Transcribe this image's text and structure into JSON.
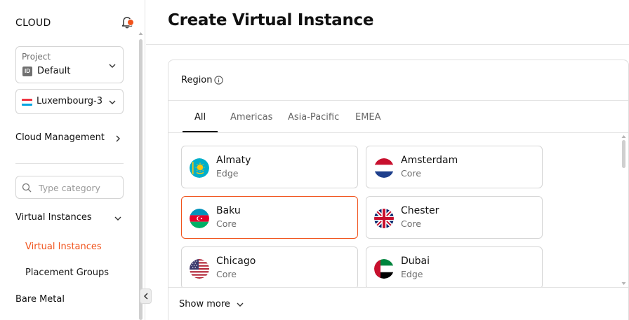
{
  "sidebar": {
    "brand": "CLOUD",
    "project": {
      "label": "Project",
      "id_badge": "ID",
      "value": "Default"
    },
    "region_selector": {
      "value": "Luxembourg-3",
      "flag_colors": [
        "#ef3340",
        "#ffffff",
        "#00a3e0"
      ]
    },
    "cloud_management": "Cloud Management",
    "category_search": {
      "placeholder": "Type category",
      "value": ""
    },
    "virtual_instances_group": "Virtual Instances",
    "items": [
      {
        "label": "Virtual Instances",
        "active": true
      },
      {
        "label": "Placement Groups",
        "active": false
      }
    ],
    "bare_metal": "Bare Metal",
    "notification_dot_color": "#f0531c"
  },
  "header": {
    "title": "Create Virtual Instance"
  },
  "region_section": {
    "label": "Region",
    "tabs": [
      {
        "label": "All",
        "active": true
      },
      {
        "label": "Americas",
        "active": false
      },
      {
        "label": "Asia-Pacific",
        "active": false
      },
      {
        "label": "EMEA",
        "active": false
      }
    ],
    "regions": [
      {
        "name": "Almaty",
        "type": "Edge",
        "flag": "kazakhstan-flag-icon",
        "selected": false
      },
      {
        "name": "Amsterdam",
        "type": "Core",
        "flag": "netherlands-flag-icon",
        "selected": false
      },
      {
        "name": "Baku",
        "type": "Core",
        "flag": "azerbaijan-flag-icon",
        "selected": true
      },
      {
        "name": "Chester",
        "type": "Core",
        "flag": "uk-flag-icon",
        "selected": false
      },
      {
        "name": "Chicago",
        "type": "Core",
        "flag": "usa-flag-icon",
        "selected": false
      },
      {
        "name": "Dubai",
        "type": "Edge",
        "flag": "uae-flag-icon",
        "selected": false
      }
    ],
    "show_more": "Show more"
  },
  "colors": {
    "accent": "#f0531c",
    "border": "#d6d6d6",
    "text_secondary": "#6e6e6e"
  }
}
